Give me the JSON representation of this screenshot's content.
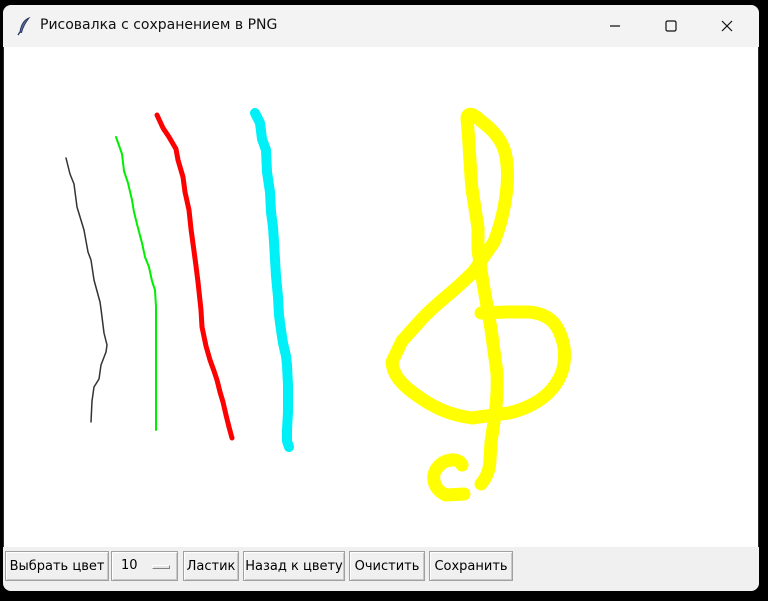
{
  "window": {
    "title": "Рисовалка с сохранением в PNG",
    "icon": "feather-icon",
    "controls": [
      "minimize-icon",
      "maximize-icon",
      "close-icon"
    ]
  },
  "canvas": {
    "background": "#ffffff",
    "strokes": [
      {
        "name": "black-line",
        "color": "#333333"
      },
      {
        "name": "green-line",
        "color": "#00ee00"
      },
      {
        "name": "red-line",
        "color": "#ff0000"
      },
      {
        "name": "cyan-line",
        "color": "#00f0f8"
      },
      {
        "name": "treble-clef",
        "color": "#ffff00"
      }
    ]
  },
  "toolbar": {
    "choose_color": "Выбрать цвет",
    "brush_size": "10",
    "eraser": "Ластик",
    "back_to_color": "Назад к цвету",
    "clear": "Очистить",
    "save": "Сохранить"
  }
}
